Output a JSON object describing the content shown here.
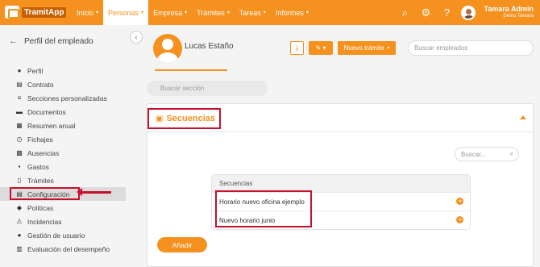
{
  "brand": {
    "name": "TramitApp"
  },
  "nav": {
    "items": [
      {
        "label": "Inicio",
        "active": false
      },
      {
        "label": "Personas",
        "active": true
      },
      {
        "label": "Empresa",
        "active": false
      },
      {
        "label": "Trámites",
        "active": false
      },
      {
        "label": "Tareas",
        "active": false
      },
      {
        "label": "Informes",
        "active": false
      }
    ]
  },
  "user": {
    "name": "Tamara Admin",
    "company": "Demo Tamara"
  },
  "sidebar": {
    "title": "Perfil del empleado",
    "items": [
      {
        "label": "Perfil",
        "icon": "user-icon"
      },
      {
        "label": "Contrato",
        "icon": "document-icon"
      },
      {
        "label": "Secciones personalizadas",
        "icon": "sliders-icon"
      },
      {
        "label": "Documentos",
        "icon": "folder-icon"
      },
      {
        "label": "Resumen anual",
        "icon": "calendar-icon"
      },
      {
        "label": "Fichajes",
        "icon": "stopwatch-icon"
      },
      {
        "label": "Ausencias",
        "icon": "calendar-x-icon"
      },
      {
        "label": "Gastos",
        "icon": "wallet-icon"
      },
      {
        "label": "Trámites",
        "icon": "file-icon"
      },
      {
        "label": "Configuración",
        "icon": "list-icon",
        "selected": true
      },
      {
        "label": "Políticas",
        "icon": "policy-icon"
      },
      {
        "label": "Incidencias",
        "icon": "alert-icon"
      },
      {
        "label": "Gestión de usuario",
        "icon": "user-gear-icon"
      },
      {
        "label": "Evaluación del desempeño",
        "icon": "chart-icon"
      }
    ]
  },
  "profile": {
    "name": "Lucas Estaño"
  },
  "toolbar": {
    "new_label": "Nuevo trámite",
    "search_placeholder": "Buscar empleados"
  },
  "section_search": {
    "placeholder": "Buscar sección"
  },
  "panel": {
    "title": "Secuencias",
    "search_placeholder": "Buscar...",
    "table_header": "Secuencias",
    "rows": [
      "Horario nuevo oficina ejemplo",
      "Nuevo horario junio"
    ],
    "add_label": "Añadir"
  },
  "colors": {
    "accent": "#f5911e",
    "annotation": "#c8102e"
  }
}
